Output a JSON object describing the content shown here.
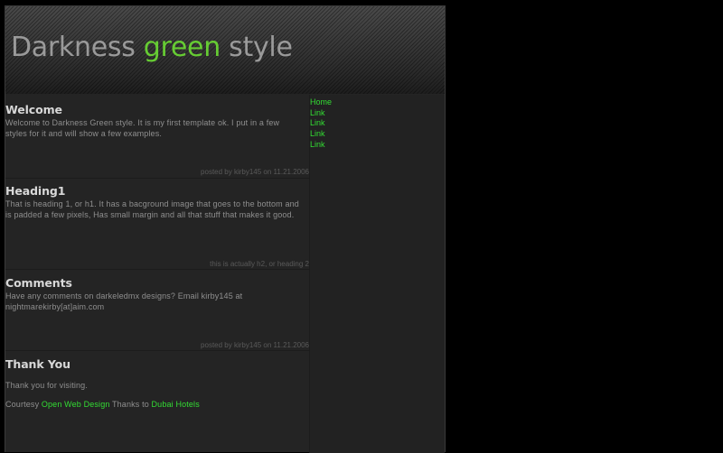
{
  "header": {
    "title_part1": "Darkness ",
    "title_accent": "green",
    "title_part2": " style"
  },
  "nav": [
    "Home",
    "Link",
    "Link",
    "Link",
    "Link"
  ],
  "posts": [
    {
      "heading": "Welcome",
      "body": "Welcome to Darkness Green style. It is my first template ok. I put in a few styles for it and will show a few examples.",
      "meta": "posted by kirby145 on 11.21.2006"
    },
    {
      "heading": "Heading1",
      "body": "That is heading 1, or h1. It has a bacground image that goes to the bottom and is padded a few pixels, Has small margin and all that stuff that makes it good.",
      "meta": "this is actually h2, or heading 2"
    },
    {
      "heading": "Comments",
      "body": "Have any comments on darkeledmx designs? Email kirby145 at nightmarekirby[at]aim.com",
      "meta": "posted by kirby145 on 11.21.2006"
    }
  ],
  "thanks": {
    "heading": "Thank You",
    "text": "Thank you for visiting.",
    "courtesy_label": "Courtesy ",
    "courtesy_link": "Open Web Design",
    "thanks_label": " Thanks to ",
    "thanks_link": "Dubai Hotels"
  },
  "colors": {
    "page_background": "#000000",
    "panel_background": "#242424",
    "accent_green": "#66cc33",
    "link_green": "#33dd33",
    "heading_text": "#d8d8d8",
    "body_text": "#8f8f8f"
  }
}
